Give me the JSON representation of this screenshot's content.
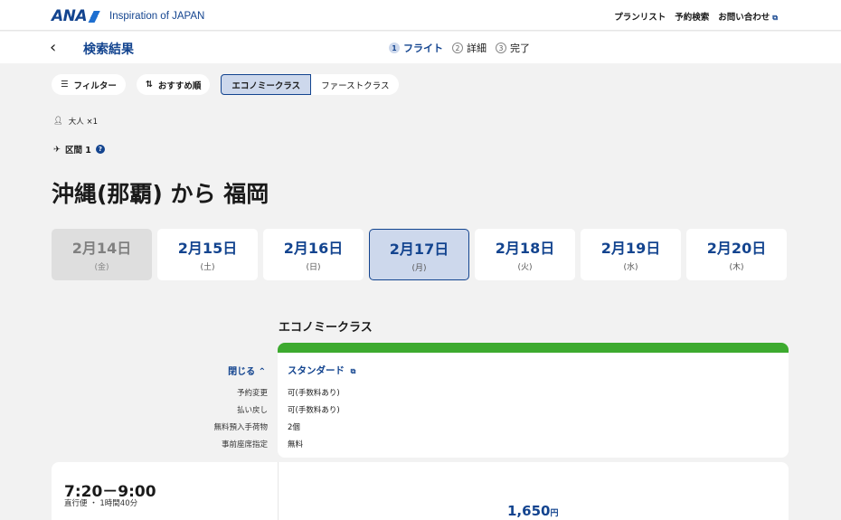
{
  "header": {
    "logo": "ANA",
    "tagline": "Inspiration of JAPAN",
    "links": [
      "プランリスト",
      "予約検索",
      "お問い合わせ"
    ]
  },
  "subheader": {
    "title": "検索結果",
    "steps": [
      {
        "num": "1",
        "label": "フライト",
        "active": true
      },
      {
        "num": "2",
        "label": "詳細",
        "active": false
      },
      {
        "num": "3",
        "label": "完了",
        "active": false
      }
    ]
  },
  "filters": {
    "filter_label": "フィルター",
    "sort_label": "おすすめ順",
    "class_options": [
      "エコノミークラス",
      "ファーストクラス"
    ],
    "selected_class": "エコノミークラス"
  },
  "passengers": "大人 ×1",
  "segment_label": "区間 1",
  "route": "沖縄(那覇) から 福岡",
  "dates": [
    {
      "date": "2月14日",
      "weekday": "(金)",
      "state": "disabled"
    },
    {
      "date": "2月15日",
      "weekday": "(土)",
      "state": "normal"
    },
    {
      "date": "2月16日",
      "weekday": "(日)",
      "state": "normal"
    },
    {
      "date": "2月17日",
      "weekday": "(月)",
      "state": "selected"
    },
    {
      "date": "2月18日",
      "weekday": "(火)",
      "state": "normal"
    },
    {
      "date": "2月19日",
      "weekday": "(水)",
      "state": "normal"
    },
    {
      "date": "2月20日",
      "weekday": "(木)",
      "state": "normal"
    }
  ],
  "fare": {
    "class_title": "エコノミークラス",
    "close_label": "閉じる",
    "fare_name": "スタンダード",
    "rows": [
      {
        "label": "予約変更",
        "value": "可(手数料あり)"
      },
      {
        "label": "払い戻し",
        "value": "可(手数料あり)"
      },
      {
        "label": "無料預入手荷物",
        "value": "2個"
      },
      {
        "label": "事前座席指定",
        "value": "無料"
      }
    ],
    "accent_color": "#3daa2f"
  },
  "flight": {
    "time": "7:20－9:00",
    "sub": "直行便 ・ 1時間40分",
    "price": "1,650",
    "currency": "円"
  },
  "colors": {
    "brand": "#13448f",
    "selected_bg": "#cdd8ec"
  }
}
